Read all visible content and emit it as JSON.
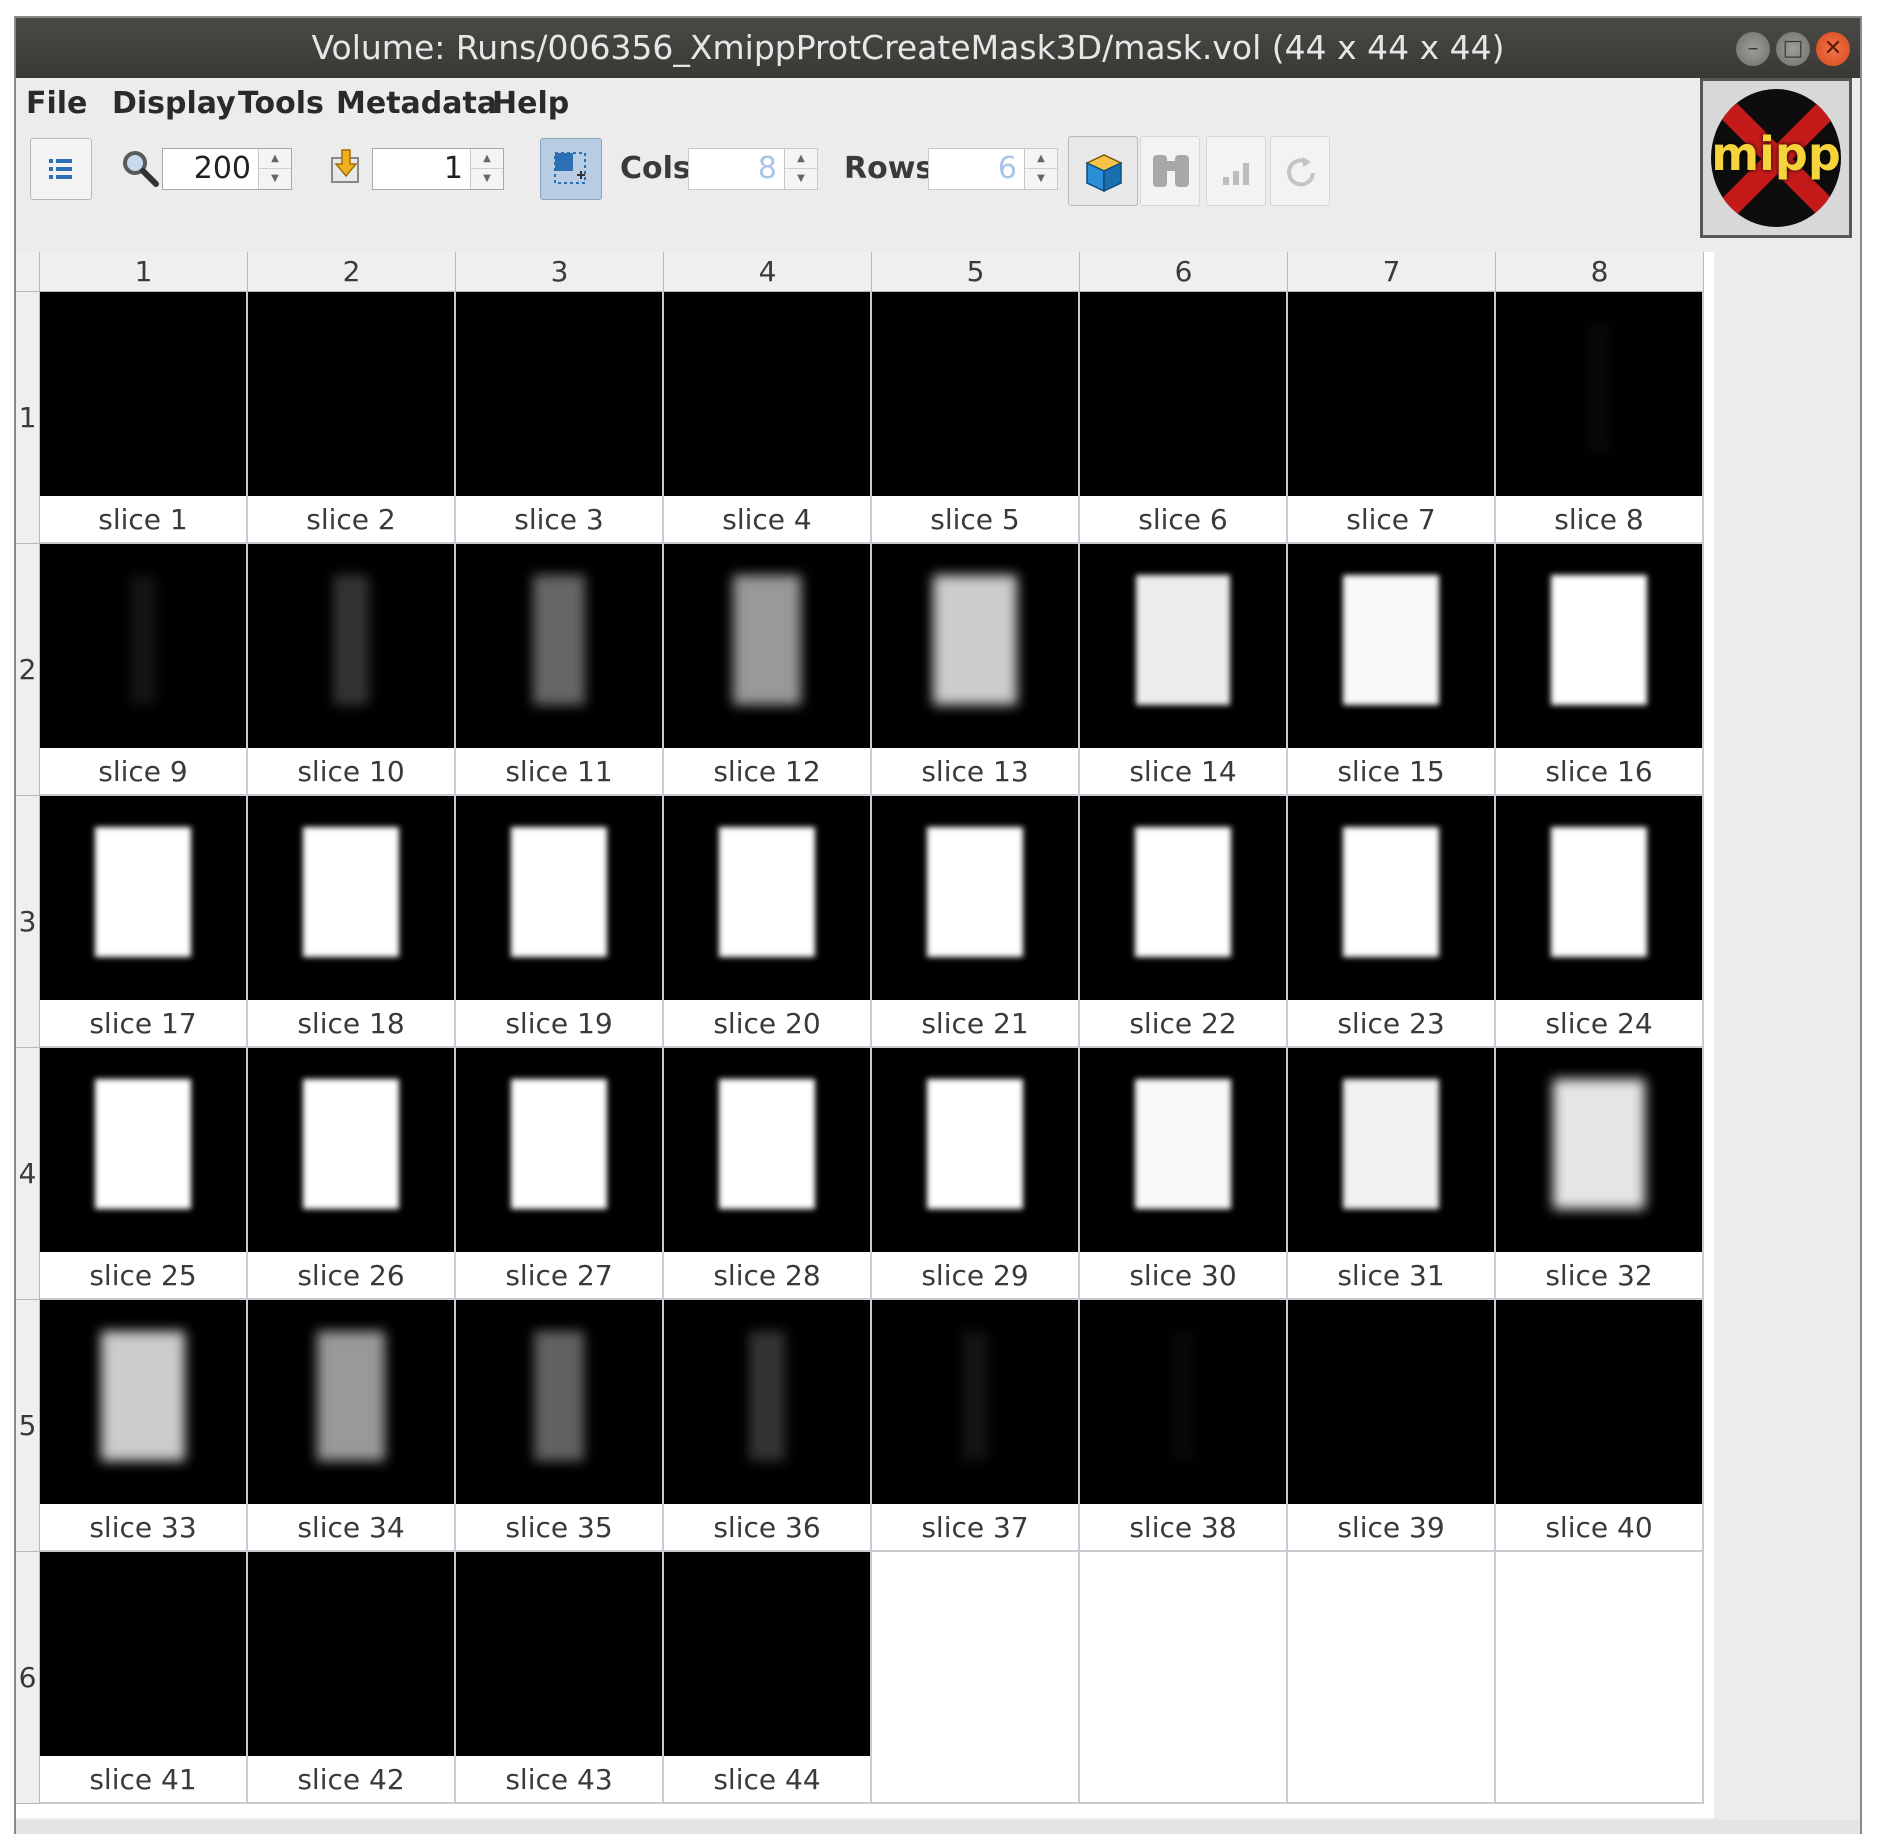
{
  "window": {
    "title": "Volume: Runs/006356_XmippProtCreateMask3D/mask.vol (44 x 44 x 44)",
    "controls": {
      "minimize": "–",
      "maximize": "□",
      "close": "✕"
    }
  },
  "menu": [
    "File",
    "Display",
    "Tools",
    "Metadata",
    "Help"
  ],
  "toolbar": {
    "zoom_value": "200",
    "goto_value": "1",
    "cols_label": "Cols",
    "cols_value": "8",
    "rows_label": "Rows",
    "rows_value": "6",
    "icons": [
      "list-icon",
      "zoom-icon",
      "goto-icon",
      "normalize-icon",
      "volume-3d-icon",
      "find-icon",
      "chart-icon",
      "reload-icon"
    ]
  },
  "logo": {
    "text": "mipp"
  },
  "gallery": {
    "column_headers": [
      "1",
      "2",
      "3",
      "4",
      "5",
      "6",
      "7",
      "8"
    ],
    "row_headers": [
      "1",
      "2",
      "3",
      "4",
      "5",
      "6"
    ],
    "slices": [
      {
        "label": "slice 1",
        "intensity": 0
      },
      {
        "label": "slice 2",
        "intensity": 0
      },
      {
        "label": "slice 3",
        "intensity": 0
      },
      {
        "label": "slice 4",
        "intensity": 0
      },
      {
        "label": "slice 5",
        "intensity": 0
      },
      {
        "label": "slice 6",
        "intensity": 0
      },
      {
        "label": "slice 7",
        "intensity": 0
      },
      {
        "label": "slice 8",
        "intensity": 0.03
      },
      {
        "label": "slice 9",
        "intensity": 0.08
      },
      {
        "label": "slice 10",
        "intensity": 0.2
      },
      {
        "label": "slice 11",
        "intensity": 0.4
      },
      {
        "label": "slice 12",
        "intensity": 0.6
      },
      {
        "label": "slice 13",
        "intensity": 0.8
      },
      {
        "label": "slice 14",
        "intensity": 0.93
      },
      {
        "label": "slice 15",
        "intensity": 0.98
      },
      {
        "label": "slice 16",
        "intensity": 1
      },
      {
        "label": "slice 17",
        "intensity": 1
      },
      {
        "label": "slice 18",
        "intensity": 1
      },
      {
        "label": "slice 19",
        "intensity": 1
      },
      {
        "label": "slice 20",
        "intensity": 1
      },
      {
        "label": "slice 21",
        "intensity": 1
      },
      {
        "label": "slice 22",
        "intensity": 1
      },
      {
        "label": "slice 23",
        "intensity": 1
      },
      {
        "label": "slice 24",
        "intensity": 1
      },
      {
        "label": "slice 25",
        "intensity": 1
      },
      {
        "label": "slice 26",
        "intensity": 1
      },
      {
        "label": "slice 27",
        "intensity": 1
      },
      {
        "label": "slice 28",
        "intensity": 1
      },
      {
        "label": "slice 29",
        "intensity": 1
      },
      {
        "label": "slice 30",
        "intensity": 0.98
      },
      {
        "label": "slice 31",
        "intensity": 0.95
      },
      {
        "label": "slice 32",
        "intensity": 0.9
      },
      {
        "label": "slice 33",
        "intensity": 0.8
      },
      {
        "label": "slice 34",
        "intensity": 0.6
      },
      {
        "label": "slice 35",
        "intensity": 0.38
      },
      {
        "label": "slice 36",
        "intensity": 0.2
      },
      {
        "label": "slice 37",
        "intensity": 0.08
      },
      {
        "label": "slice 38",
        "intensity": 0.03
      },
      {
        "label": "slice 39",
        "intensity": 0
      },
      {
        "label": "slice 40",
        "intensity": 0
      },
      {
        "label": "slice 41",
        "intensity": 0
      },
      {
        "label": "slice 42",
        "intensity": 0
      },
      {
        "label": "slice 43",
        "intensity": 0
      },
      {
        "label": "slice 44",
        "intensity": 0
      }
    ]
  },
  "colors": {
    "title_text": "#e6e6e6",
    "close_button": "#d8481c",
    "disabled_spinner_text": "#aac4e6"
  }
}
